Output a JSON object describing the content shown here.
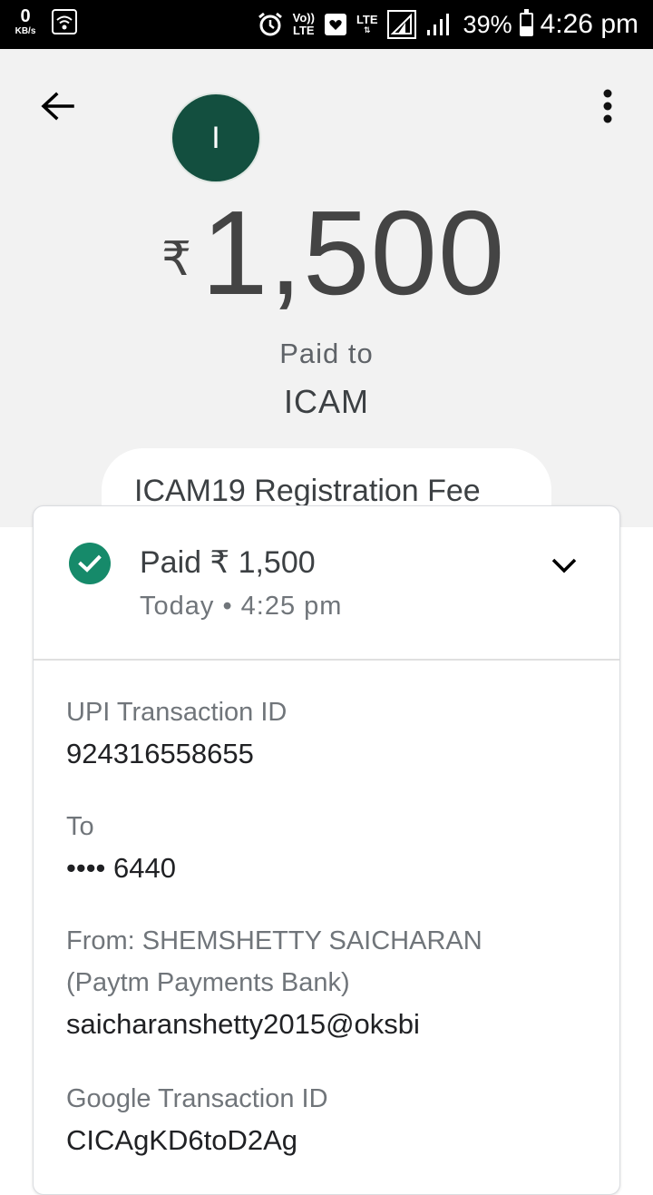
{
  "status_bar": {
    "data_speed": "0",
    "data_unit": "KB/s",
    "volte_top": "Vo))",
    "volte_bottom": "LTE",
    "lte_label": "LTE",
    "battery_percent": "39%",
    "battery_level": 0.39,
    "time": "4:26 pm"
  },
  "header": {
    "avatar_initial": "I",
    "currency_symbol": "₹",
    "amount": "1,500",
    "paid_to_label": "Paid to",
    "payee_name": "ICAM",
    "note": "ICAM19 Registration Fee"
  },
  "status": {
    "title": "Paid ₹ 1,500",
    "date": "Today • 4:25 pm"
  },
  "details": {
    "upi_label": "UPI Transaction ID",
    "upi_value": "924316558655",
    "to_label": "To",
    "to_value": "•••• 6440",
    "from_label_line1": "From: SHEMSHETTY SAICHARAN",
    "from_label_line2": "(Paytm Payments Bank)",
    "from_value": "saicharanshetty2015@oksbi",
    "google_label": "Google Transaction ID",
    "google_value": "CICAgKD6toD2Ag"
  },
  "colors": {
    "success_green": "#168a6a",
    "avatar_bg": "#134f3f",
    "header_bg": "#f2f2f2"
  },
  "icons": {
    "back": "arrow-back-icon",
    "menu": "more-vert-icon",
    "status": "check-circle-icon",
    "expand": "chevron-down-icon"
  }
}
